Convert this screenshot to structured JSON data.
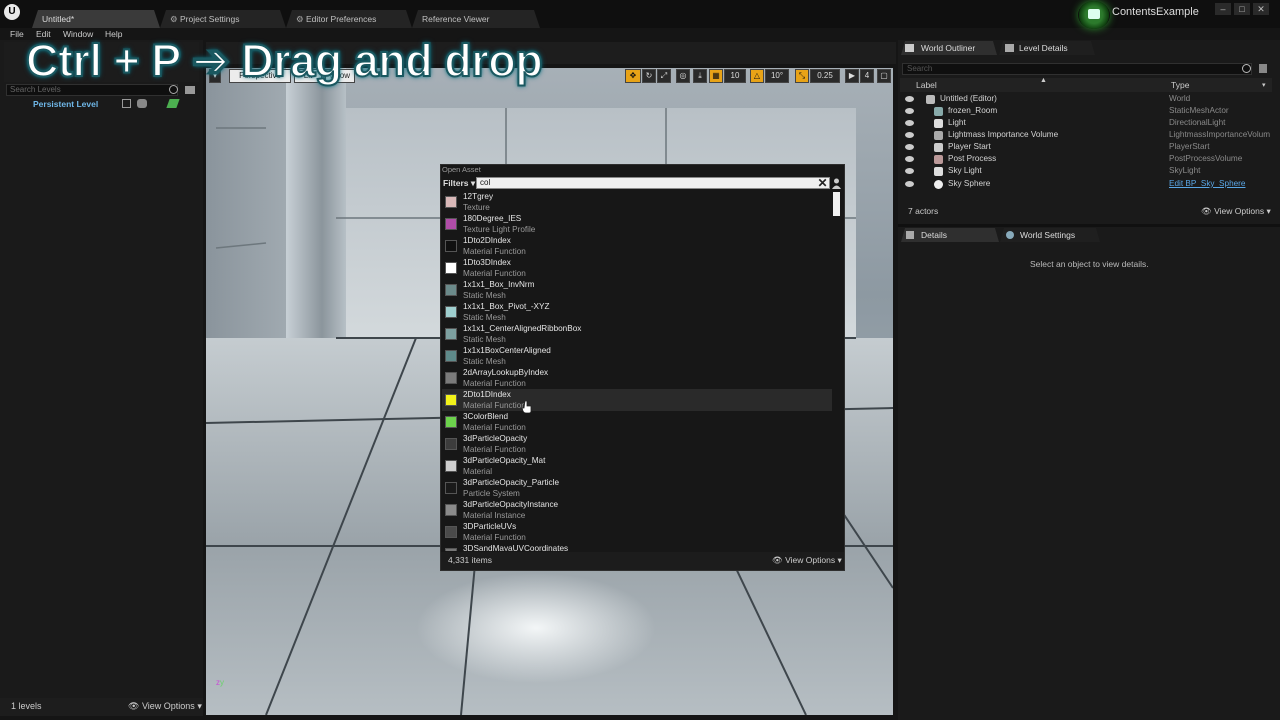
{
  "window": {
    "tabs": [
      "Untitled*",
      "Project Settings",
      "Editor Preferences",
      "Reference Viewer"
    ],
    "project_name": "ContentsExample",
    "controls": [
      "–",
      "□",
      "✕"
    ]
  },
  "menu": [
    "File",
    "Edit",
    "Window",
    "Help"
  ],
  "overlay_caption": "Ctrl + P ➔ Drag and drop",
  "levels": {
    "search_placeholder": "Search Levels",
    "persistent_level": "Persistent Level",
    "count": "1 levels",
    "view_options": "View Options"
  },
  "viewport_toolbar": {
    "perspective": "Perspective",
    "lit": "Lit",
    "show": "Show",
    "grid_snap": "10",
    "rotation_snap": "10°",
    "scale_snap": "0.25",
    "camera_speed": "4"
  },
  "open_asset": {
    "title": "Open Asset",
    "filters_label": "Filters",
    "search_value": "col",
    "items": [
      {
        "name": "12Tgrey",
        "type": "Texture",
        "color": "#d9b8b8"
      },
      {
        "name": "180Degree_IES",
        "type": "Texture Light Profile",
        "color": "#b04da8"
      },
      {
        "name": "1Dto2DIndex",
        "type": "Material Function",
        "color": "#101010"
      },
      {
        "name": "1Dto3DIndex",
        "type": "Material Function",
        "color": "#ffffff"
      },
      {
        "name": "1x1x1_Box_InvNrm",
        "type": "Static Mesh",
        "color": "#6b8a8a"
      },
      {
        "name": "1x1x1_Box_Pivot_-XYZ",
        "type": "Static Mesh",
        "color": "#9fcfcf"
      },
      {
        "name": "1x1x1_CenterAlignedRibbonBox",
        "type": "Static Mesh",
        "color": "#7da0a0"
      },
      {
        "name": "1x1x1BoxCenterAligned",
        "type": "Static Mesh",
        "color": "#5f8a8a"
      },
      {
        "name": "2dArrayLookupByIndex",
        "type": "Material Function",
        "color": "#7b7b7b"
      },
      {
        "name": "2Dto1DIndex",
        "type": "Material Function",
        "color": "#f2f21a",
        "highlight": true
      },
      {
        "name": "3ColorBlend",
        "type": "Material Function",
        "color": "#6cd24c"
      },
      {
        "name": "3dParticleOpacity",
        "type": "Material Function",
        "color": "#3c3c3c"
      },
      {
        "name": "3dParticleOpacity_Mat",
        "type": "Material",
        "color": "#cfcfcf"
      },
      {
        "name": "3dParticleOpacity_Particle",
        "type": "Particle System",
        "color": "#1a1a1a"
      },
      {
        "name": "3dParticleOpacityInstance",
        "type": "Material Instance",
        "color": "#8a8a8a"
      },
      {
        "name": "3DParticleUVs",
        "type": "Material Function",
        "color": "#4a4a4a"
      },
      {
        "name": "3DSandMayaUVCoordinates",
        "type": "",
        "color": "#777777"
      }
    ],
    "item_count": "4,331 items",
    "view_options": "View Options"
  },
  "outliner": {
    "tab": "World Outliner",
    "tab2": "Level Details",
    "search_placeholder": "Search",
    "col_label": "Label",
    "col_type": "Type",
    "rows": [
      {
        "label": "Untitled (Editor)",
        "type": "World"
      },
      {
        "label": "frozen_Room",
        "type": "StaticMeshActor"
      },
      {
        "label": "Light",
        "type": "DirectionalLight"
      },
      {
        "label": "Lightmass Importance Volume",
        "type": "LightmassImportanceVolum"
      },
      {
        "label": "Player Start",
        "type": "PlayerStart"
      },
      {
        "label": "Post Process",
        "type": "PostProcessVolume"
      },
      {
        "label": "Sky Light",
        "type": "SkyLight"
      },
      {
        "label": "Sky Sphere",
        "type": "Edit BP_Sky_Sphere",
        "link": true
      }
    ],
    "actor_count": "7 actors",
    "view_options": "View Options"
  },
  "details": {
    "tab": "Details",
    "tab2": "World Settings",
    "empty_message": "Select an object to view details."
  }
}
